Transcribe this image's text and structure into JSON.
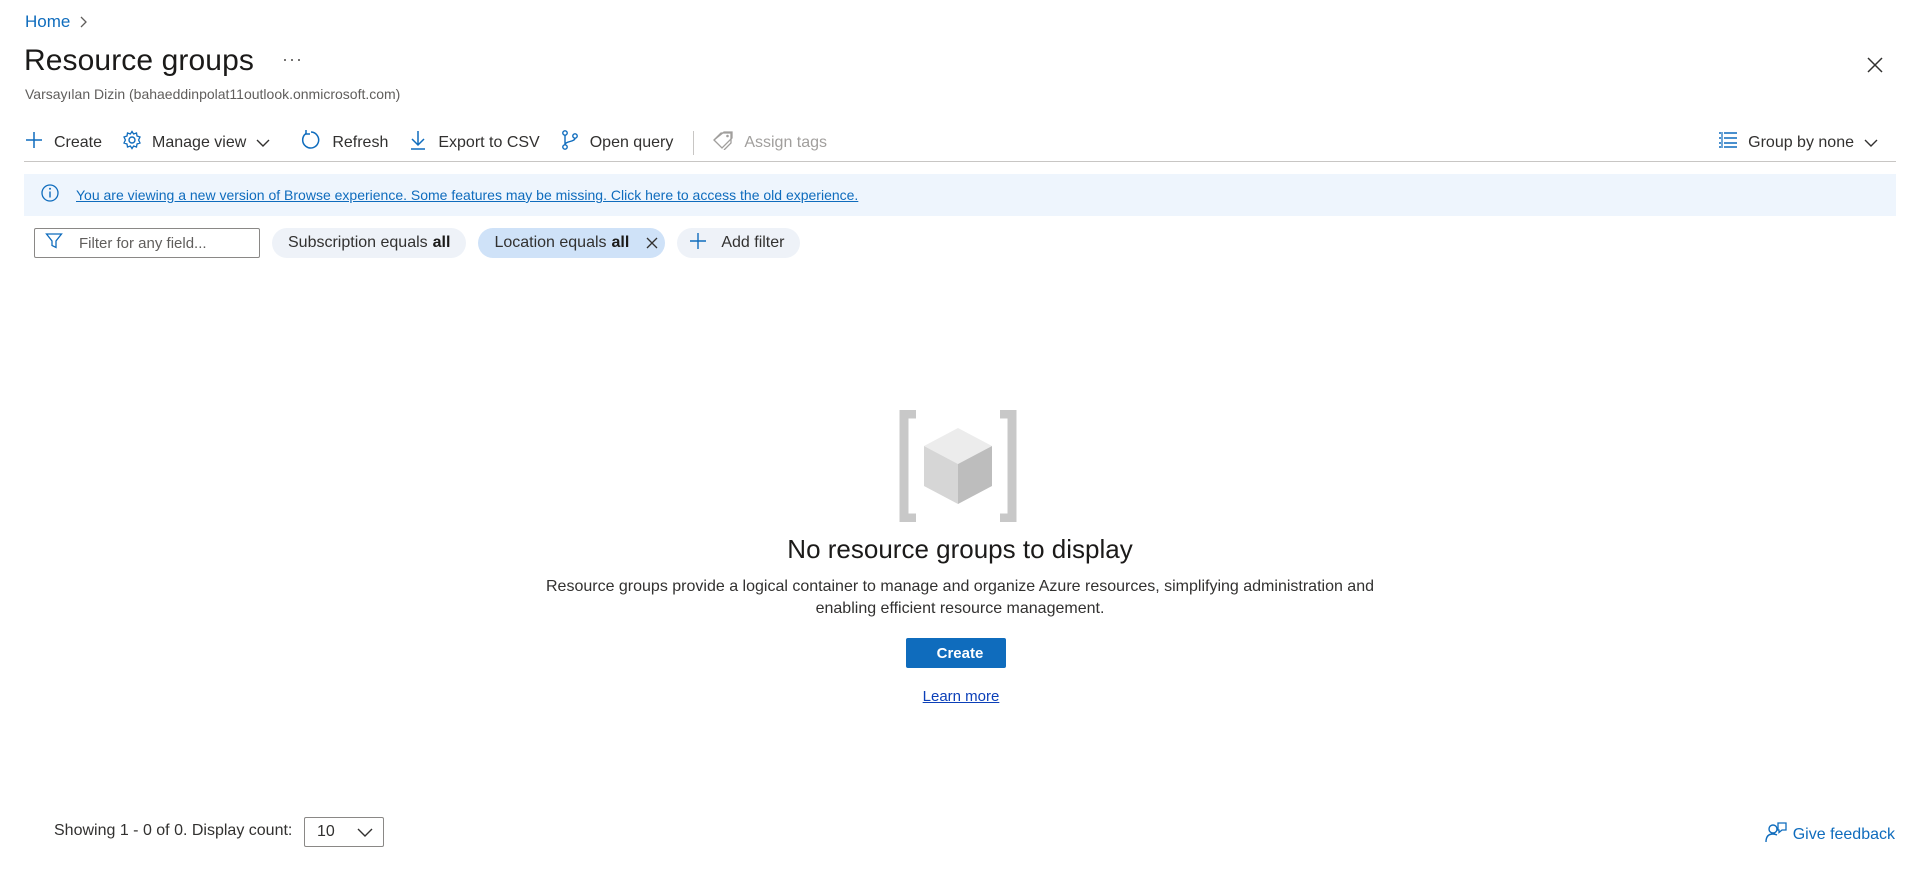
{
  "breadcrumb": {
    "home": "Home"
  },
  "header": {
    "title": "Resource groups",
    "more": "···",
    "subtitle": "Varsayılan Dizin (bahaeddinpolat11outlook.onmicrosoft.com)"
  },
  "toolbar": {
    "create": "Create",
    "manage_view": "Manage view",
    "refresh": "Refresh",
    "export_csv": "Export to CSV",
    "open_query": "Open query",
    "assign_tags": "Assign tags",
    "group_by": "Group by none"
  },
  "banner": {
    "text": "You are viewing a new version of Browse experience. Some features may be missing. Click here to access the old experience."
  },
  "filters": {
    "placeholder": "Filter for any field...",
    "subscription_label": "Subscription equals",
    "subscription_value": "all",
    "location_label": "Location equals",
    "location_value": "all",
    "add_filter": "Add filter"
  },
  "empty": {
    "title": "No resource groups to display",
    "description": "Resource groups provide a logical container to manage and organize Azure resources, simplifying administration and enabling efficient resource management.",
    "create": "Create",
    "learn_more": "Learn more"
  },
  "footer": {
    "showing": "Showing 1 - 0 of 0. Display count:",
    "count": "10",
    "feedback": "Give feedback"
  },
  "colors": {
    "accent": "#0f6cbd",
    "banner_bg": "#eef5fd",
    "pill_bg": "#eef2f8",
    "pill_active_bg": "#cfe2f8"
  },
  "icons": [
    "chevron-right-icon",
    "close-icon",
    "plus-icon",
    "gear-icon",
    "chevron-down-icon",
    "refresh-icon",
    "download-icon",
    "query-icon",
    "tag-icon",
    "group-list-icon",
    "info-icon",
    "filter-icon",
    "resource-group-icon",
    "feedback-icon"
  ]
}
